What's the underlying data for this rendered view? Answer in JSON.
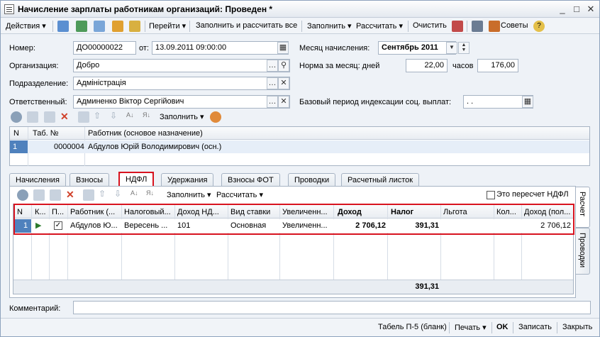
{
  "window": {
    "title": "Начисление зарплаты работникам организаций: Проведен *",
    "min": "_",
    "max": "□",
    "close": "✕"
  },
  "toolbar": {
    "actions": "Действия ▾",
    "goto": "Перейти ▾",
    "fill_calc_all": "Заполнить и рассчитать все",
    "fill": "Заполнить ▾",
    "calc": "Рассчитать ▾",
    "clear": "Очистить",
    "tips": "Советы"
  },
  "header": {
    "number_label": "Номер:",
    "number_value": "ДО00000022",
    "from_label": "от:",
    "date_value": "13.09.2011 09:00:00",
    "accrual_month_label": "Месяц начисления:",
    "accrual_month_value": "Сентябрь 2011",
    "org_label": "Организация:",
    "org_value": "Добро",
    "norm_label": "Норма за месяц: дней",
    "norm_days": "22,00",
    "hours_label": "часов",
    "norm_hours": "176,00",
    "dept_label": "Подразделение:",
    "dept_value": "Адміністрація",
    "resp_label": "Ответственный:",
    "resp_value": "Админенко Віктор Сергійович",
    "base_period_label": "Базовый период индексации соц. выплат:",
    "base_period_value": " .  ."
  },
  "workers": {
    "fill_label": "Заполнить ▾",
    "columns": [
      "N",
      "Таб. №",
      "Работник (основое назначение)"
    ],
    "rows": [
      {
        "n": "1",
        "tab": "0000004",
        "worker": "Абдулов Юрій Володимирович (осн.)"
      }
    ]
  },
  "tabs": [
    "Начисления",
    "Взносы",
    "НДФЛ",
    "Удержания",
    "Взносы ФОТ",
    "Проводки",
    "Расчетный листок"
  ],
  "ndfl": {
    "fill_label": "Заполнить ▾",
    "calc_label": "Рассчитать ▾",
    "recalc_label": "Это пересчет НДФЛ",
    "columns": [
      "N",
      "К...",
      "П...",
      "Работник (...",
      "Налоговый...",
      "Доход НД...",
      "Вид ставки",
      "Увеличенн...",
      "Доход",
      "Налог",
      "Льгота",
      "Кол...",
      "Доход (пол..."
    ],
    "row": {
      "n": "1",
      "worker": "Абдулов Ю...",
      "period": "Вересень ...",
      "code": "101",
      "rate": "Основная",
      "increased": "Увеличенн...",
      "income": "2 706,12",
      "tax": "391,31",
      "benefit": "",
      "count": "",
      "income_full": "2 706,12"
    },
    "total_tax": "391,31"
  },
  "side_tabs": [
    "Расчет",
    "Проводки"
  ],
  "comment_label": "Комментарий:",
  "footer": {
    "tabel": "Табель П-5 (бланк)",
    "print": "Печать ▾",
    "ok": "OK",
    "save": "Записать",
    "close": "Закрыть"
  }
}
